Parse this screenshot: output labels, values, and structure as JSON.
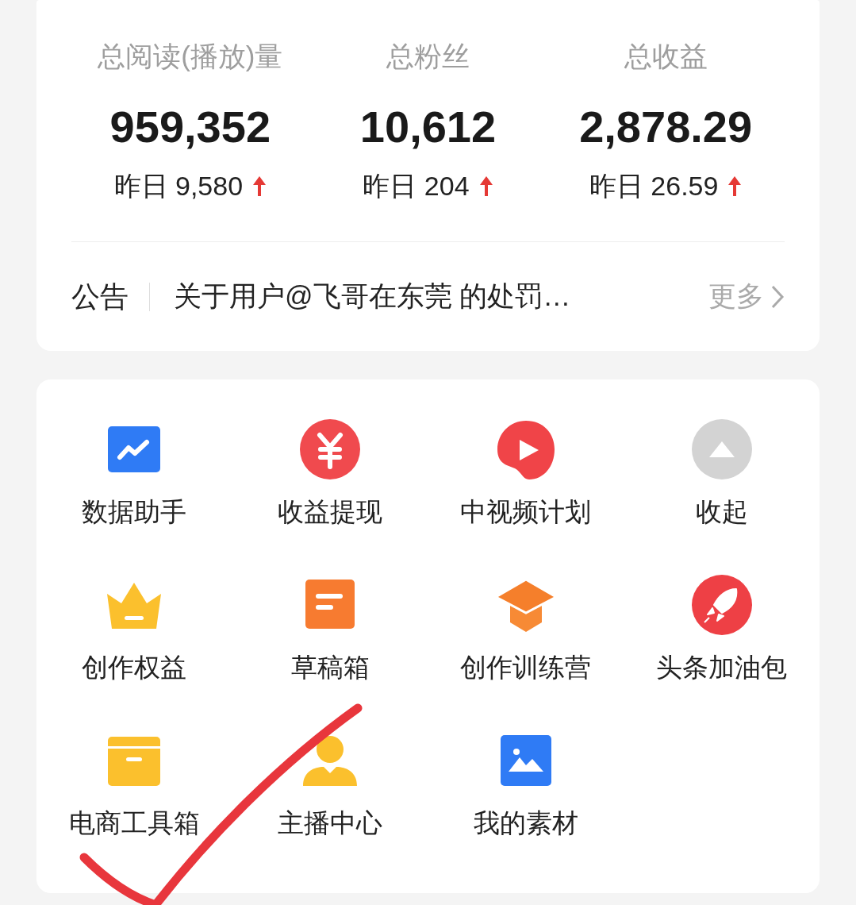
{
  "stats": [
    {
      "label": "总阅读(播放)量",
      "value": "959,352",
      "yesterday_label": "昨日",
      "yesterday": "9,580",
      "rising": true
    },
    {
      "label": "总粉丝",
      "value": "10,612",
      "yesterday_label": "昨日",
      "yesterday": "204",
      "rising": true
    },
    {
      "label": "总收益",
      "value": "2,878.29",
      "yesterday_label": "昨日",
      "yesterday": "26.59",
      "rising": true
    }
  ],
  "notice": {
    "label": "公告",
    "text": "关于用户@飞哥在东莞 的处罚…",
    "more": "更多"
  },
  "tools": [
    {
      "kind": "chart",
      "label": "数据助手"
    },
    {
      "kind": "yuan",
      "label": "收益提现"
    },
    {
      "kind": "play",
      "label": "中视频计划"
    },
    {
      "kind": "collapse",
      "label": "收起"
    },
    {
      "kind": "crown",
      "label": "创作权益"
    },
    {
      "kind": "draft",
      "label": "草稿箱"
    },
    {
      "kind": "cap",
      "label": "创作训练营"
    },
    {
      "kind": "rocket",
      "label": "头条加油包"
    },
    {
      "kind": "box",
      "label": "电商工具箱"
    },
    {
      "kind": "person",
      "label": "主播中心"
    },
    {
      "kind": "image",
      "label": "我的素材"
    }
  ]
}
